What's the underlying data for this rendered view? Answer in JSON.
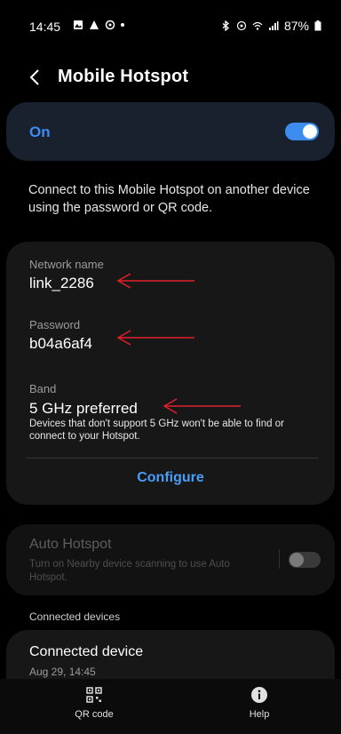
{
  "status_bar": {
    "time": "14:45",
    "battery": "87%"
  },
  "header": {
    "title": "Mobile Hotspot"
  },
  "hotspot": {
    "state_label": "On",
    "enabled": true
  },
  "description": "Connect to this Mobile Hotspot on another device using the password or QR code.",
  "details": {
    "network_name_label": "Network name",
    "network_name": "link_2286",
    "password_label": "Password",
    "password": "b04a6af4",
    "band_label": "Band",
    "band": "5 GHz preferred",
    "band_note": "Devices that don't support 5 GHz won't be able to find or connect to your Hotspot.",
    "configure_label": "Configure"
  },
  "auto_hotspot": {
    "title": "Auto Hotspot",
    "subtitle": "Turn on Nearby device scanning to use Auto Hotspot.",
    "enabled": false
  },
  "connected": {
    "section_label": "Connected devices",
    "devices": [
      {
        "name": "Connected device",
        "date": "Aug 29, 14:45"
      }
    ]
  },
  "bottom_nav": {
    "qr_label": "QR code",
    "help_label": "Help"
  },
  "colors": {
    "accent": "#3d8cf0",
    "annotation_arrow": "#e0202a"
  },
  "icons": [
    "image-icon",
    "warning-icon",
    "sync-icon",
    "bluetooth-icon",
    "hotspot-icon",
    "wifi-icon",
    "signal-icon",
    "battery-icon",
    "back-icon",
    "qr-code-icon",
    "help-icon"
  ]
}
